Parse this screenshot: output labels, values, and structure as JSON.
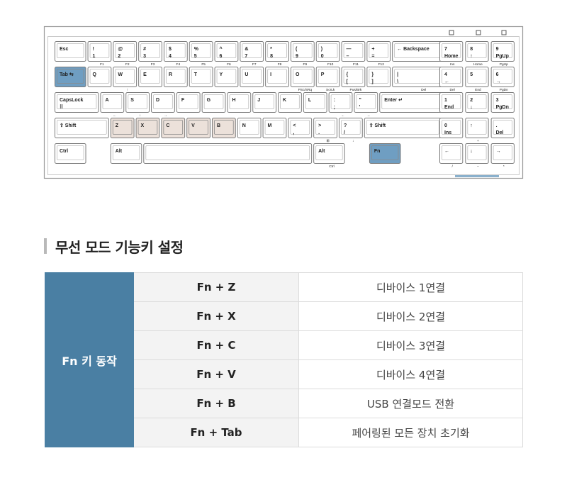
{
  "keyboard": {
    "rows": [
      [
        {
          "top": "Esc"
        },
        {
          "top": "!",
          "mid": "1",
          "sub": "F1"
        },
        {
          "top": "@",
          "mid": "2",
          "sub": "F2"
        },
        {
          "top": "#",
          "mid": "3",
          "sub": "F3"
        },
        {
          "top": "$",
          "mid": "4",
          "sub": "F4"
        },
        {
          "top": "%",
          "mid": "5",
          "sub": "F5"
        },
        {
          "top": "^",
          "mid": "6",
          "sub": "F6"
        },
        {
          "top": "&",
          "mid": "7",
          "sub": "F7"
        },
        {
          "top": "*",
          "mid": "8",
          "sub": "F8"
        },
        {
          "top": "(",
          "mid": "9",
          "sub": "F9"
        },
        {
          "top": ")",
          "mid": "0",
          "sub": "F10"
        },
        {
          "top": "—",
          "mid": "–",
          "sub": "F11"
        },
        {
          "top": "+",
          "mid": "=",
          "sub": "F12"
        },
        {
          "top": "← Backspace",
          "sub": ""
        }
      ],
      [
        {
          "top": "Tab ⇆"
        },
        {
          "top": "Q"
        },
        {
          "top": "W",
          "sub": "↑"
        },
        {
          "top": "E"
        },
        {
          "top": "R"
        },
        {
          "top": "T"
        },
        {
          "top": "Y"
        },
        {
          "top": "U"
        },
        {
          "top": "I"
        },
        {
          "top": "O",
          "sub": "PSc/SRq"
        },
        {
          "top": "P",
          "sub": "ScrLk"
        },
        {
          "top": "{",
          "mid": "[",
          "sub": "Pus/Brk"
        },
        {
          "top": "}",
          "mid": "]"
        },
        {
          "top": "|",
          "mid": "\\",
          "sub": "Del"
        }
      ],
      [
        {
          "top": "CapsLock",
          "mid": "⠿"
        },
        {
          "top": "A",
          "sub": "←"
        },
        {
          "top": "S",
          "sub": "↓"
        },
        {
          "top": "D",
          "sub": "→"
        },
        {
          "top": "F"
        },
        {
          "top": "G"
        },
        {
          "top": "H"
        },
        {
          "top": "J"
        },
        {
          "top": "K"
        },
        {
          "top": "L"
        },
        {
          "top": ":",
          "mid": ";",
          "sub": "←"
        },
        {
          "top": "\"",
          "mid": "'",
          "sub": "→"
        },
        {
          "top": "Enter ↵"
        }
      ],
      [
        {
          "top": "⇧ Shift"
        },
        {
          "top": "Z"
        },
        {
          "top": "X"
        },
        {
          "top": "C"
        },
        {
          "top": "V"
        },
        {
          "top": "B"
        },
        {
          "top": "N"
        },
        {
          "top": "M"
        },
        {
          "top": "<",
          "mid": ","
        },
        {
          "top": ">",
          "mid": ".",
          "sub": "⊞"
        },
        {
          "top": "?",
          "mid": "/",
          "sub": "↓"
        },
        {
          "top": "⇧ Shift"
        }
      ],
      [
        {
          "top": "Ctrl"
        },
        {
          "top": "Alt"
        },
        {
          "top": ""
        },
        {
          "top": "Alt",
          "sub": "Ctrl"
        },
        {
          "top": "Fn"
        }
      ]
    ],
    "numpad": [
      [
        {
          "top": "7",
          "sub": "Home",
          "sub2": "Ins"
        },
        {
          "top": "8",
          "sub": "↑",
          "sub2": "Home"
        },
        {
          "top": "9",
          "sub": "PgUp",
          "sub2": "PgUp"
        }
      ],
      [
        {
          "top": "4",
          "sub": "←",
          "sub2": "Del"
        },
        {
          "top": "5",
          "sub": "",
          "sub2": "End"
        },
        {
          "top": "6",
          "sub": "→",
          "sub2": "PgDn"
        }
      ],
      [
        {
          "top": "1",
          "sub": "End"
        },
        {
          "top": "2",
          "sub": "↓"
        },
        {
          "top": "3",
          "sub": "PgDn"
        }
      ],
      [
        {
          "top": "0",
          "sub": "Ins"
        },
        {
          "top": "↑",
          "sub2": "+"
        },
        {
          "top": ".",
          "sub": "Del"
        }
      ],
      [
        {
          "top": "←",
          "sub2": "/"
        },
        {
          "top": "↓",
          "sub2": "−"
        },
        {
          "top": "→",
          "sub2": "*"
        }
      ]
    ]
  },
  "section": {
    "title": "무선 모드 기능키 설정"
  },
  "table": {
    "header": "Fn 키 동작",
    "rows": [
      {
        "combo": "Fn + Z",
        "desc": "디바이스 1연결"
      },
      {
        "combo": "Fn + X",
        "desc": "디바이스 2연결"
      },
      {
        "combo": "Fn + C",
        "desc": "디바이스 3연결"
      },
      {
        "combo": "Fn + V",
        "desc": "디바이스 4연결"
      },
      {
        "combo": "Fn + B",
        "desc": "USB 연결모드 전환"
      },
      {
        "combo": "Fn + Tab",
        "desc": "페어링된 모든 장치 초기화"
      }
    ]
  },
  "colors": {
    "highlight_blue": "#6f9ec2",
    "highlight_beige": "#ece1da",
    "header_blue": "#4a7fa3"
  }
}
